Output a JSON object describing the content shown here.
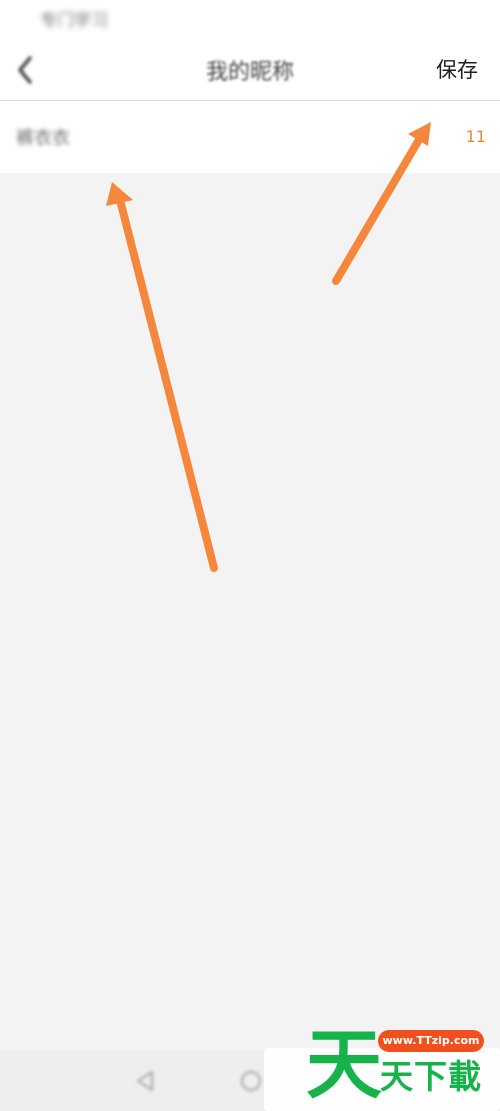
{
  "status_bar": {
    "text": "专门学习"
  },
  "nav": {
    "back_icon": "chevron-left-icon",
    "title": "我的昵称",
    "save_label": "保存"
  },
  "nickname": {
    "value": "裤衣衣",
    "char_count": "11"
  },
  "annotations": {
    "arrow_color": "#f4873c",
    "arrows": [
      "arrow-to-nickname-input",
      "arrow-to-char-count"
    ]
  },
  "bottom_nav": {
    "back_icon": "triangle-back-icon",
    "home_icon": "circle-home-icon"
  },
  "watermark": {
    "big_char": "天",
    "url": "www.TTzip.com",
    "text": "天下載",
    "green": "#16b34a",
    "orange": "#f0501e"
  }
}
